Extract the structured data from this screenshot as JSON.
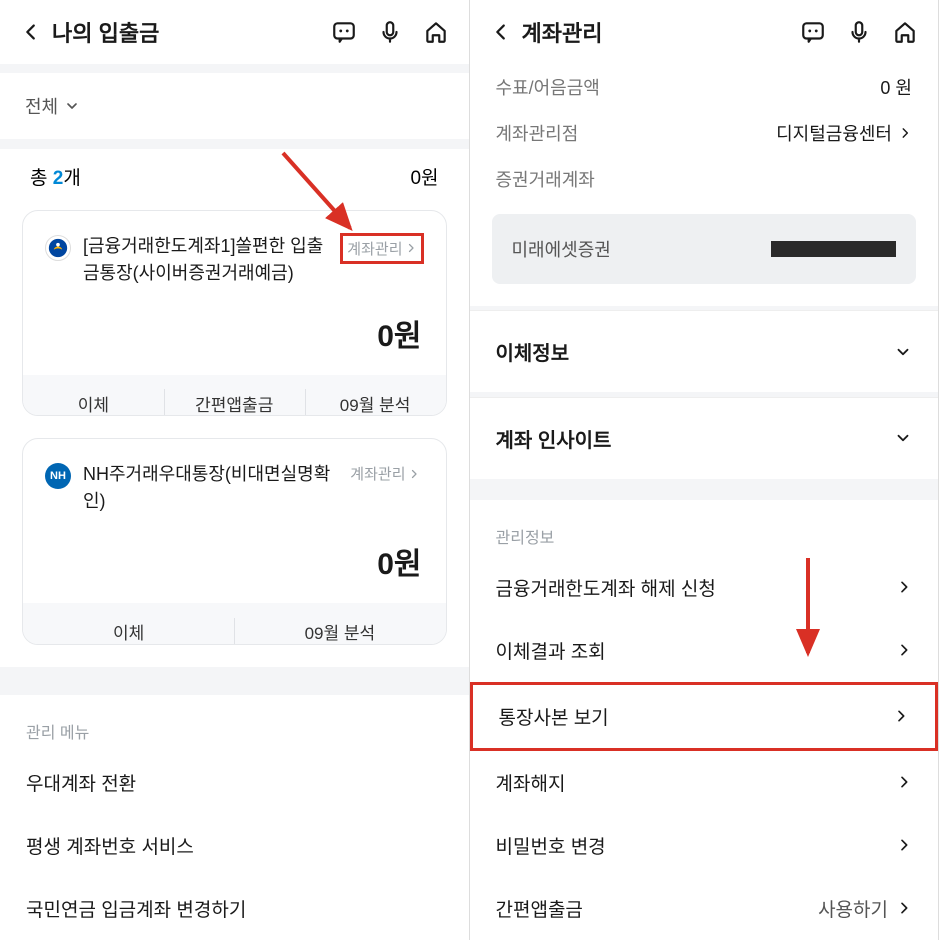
{
  "left": {
    "title": "나의 입출금",
    "filter": "전체",
    "total_label_pre": "총 ",
    "total_count": "2",
    "total_label_post": "개",
    "total_amount": "0원",
    "cards": [
      {
        "bank": "shinhan",
        "name": "[금융거래한도계좌1]쏠편한 입출금통장(사이버증권거래예금)",
        "mgmt": "계좌관리",
        "balance": "0원",
        "actions": [
          "이체",
          "간편앱출금",
          "09월 분석"
        ],
        "highlight": true
      },
      {
        "bank": "nh",
        "name": "NH주거래우대통장(비대면실명확인)",
        "mgmt": "계좌관리",
        "balance": "0원",
        "actions": [
          "이체",
          "09월 분석"
        ]
      }
    ],
    "menu_label": "관리 메뉴",
    "menu_items": [
      "우대계좌 전환",
      "평생 계좌번호 서비스",
      "국민연금 입금계좌 변경하기"
    ]
  },
  "right": {
    "title": "계좌관리",
    "info_rows": [
      {
        "k": "수표/어음금액",
        "v": "0 원"
      },
      {
        "k": "계좌관리점",
        "v": "디지털금융센터",
        "chev": true
      },
      {
        "k": "증권거래계좌",
        "plain": true
      }
    ],
    "security_name": "미래에셋증권",
    "expanders": [
      "이체정보",
      "계좌 인사이트"
    ],
    "mgmt_label": "관리정보",
    "mgmt_items": [
      {
        "label": "금융거래한도계좌 해제 신청"
      },
      {
        "label": "이체결과 조회"
      },
      {
        "label": "통장사본 보기",
        "highlight": true
      },
      {
        "label": "계좌해지"
      },
      {
        "label": "비밀번호 변경"
      },
      {
        "label": "간편앱출금",
        "action": "사용하기"
      }
    ]
  }
}
